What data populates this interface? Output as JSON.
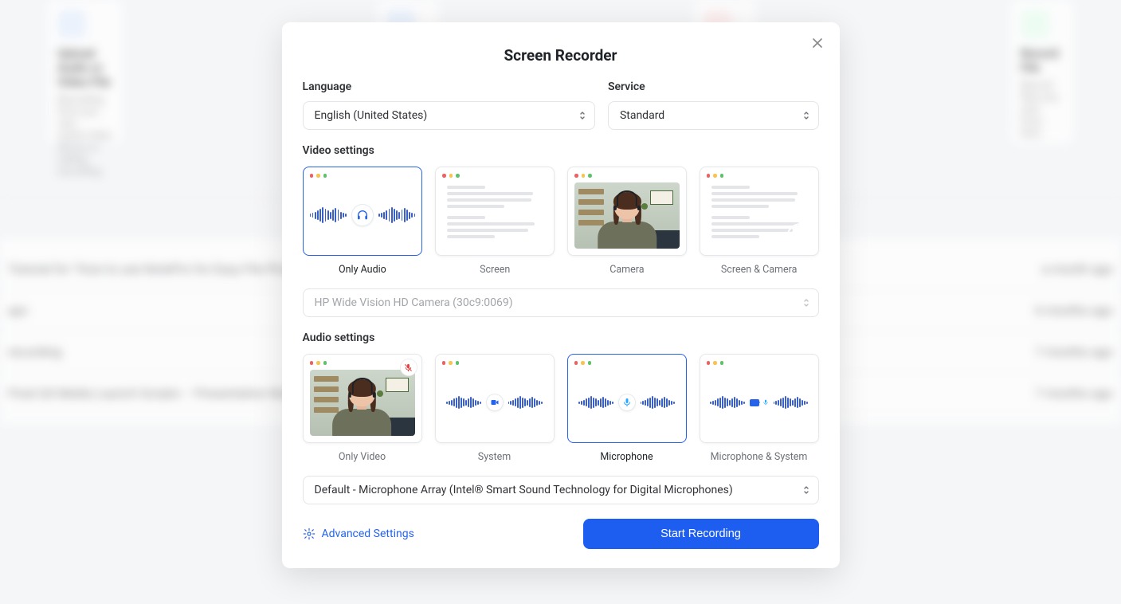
{
  "modal": {
    "title": "Screen Recorder",
    "language_label": "Language",
    "language_value": "English (United States)",
    "service_label": "Service",
    "service_value": "Standard",
    "video_settings_label": "Video settings",
    "video_options": {
      "only_audio": "Only Audio",
      "screen": "Screen",
      "camera": "Camera",
      "screen_camera": "Screen & Camera"
    },
    "video_selected": "only_audio",
    "camera_select_value": "HP Wide Vision HD Camera (30c9:0069)",
    "audio_settings_label": "Audio settings",
    "audio_options": {
      "only_video": "Only Video",
      "system": "System",
      "microphone": "Microphone",
      "mic_system": "Microphone & System"
    },
    "audio_selected": "microphone",
    "mic_select_value": "Default - Microphone Array (Intel® Smart Sound Technology for Digital Microphones)",
    "advanced_settings": "Advanced Settings",
    "start_button": "Start Recording"
  },
  "background": {
    "card1_title": "Upload Audio or Video File",
    "card1_desc": "Recording from you own audio/video device or calling recording.",
    "card4_title": "Record File",
    "card4_desc": "Record files you own from here."
  }
}
